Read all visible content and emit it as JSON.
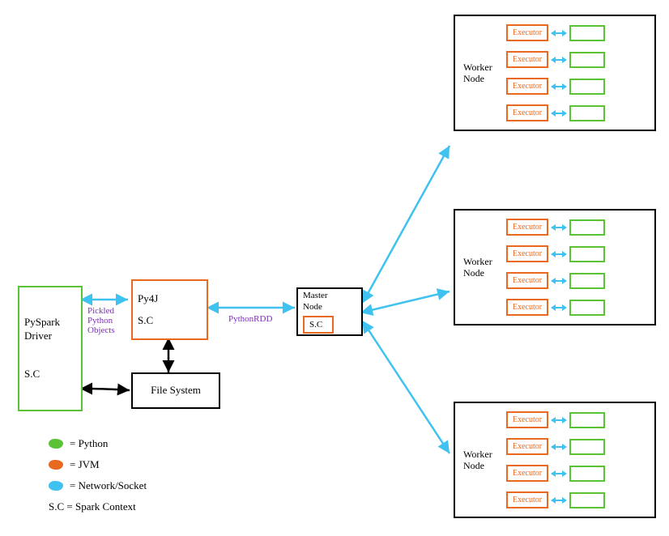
{
  "driver": {
    "title": "PySpark\nDriver",
    "sc": "S.C"
  },
  "py4j": {
    "title": "Py4J",
    "sc": "S.C"
  },
  "filesystem": "File System",
  "master": {
    "title": "Master\nNode",
    "sc": "S.C"
  },
  "labels": {
    "pickled": "Pickled\nPython\nObjects",
    "pythonRDD": "PythonRDD"
  },
  "worker": {
    "label": "Worker\nNode",
    "executor": "Executor"
  },
  "legend": {
    "python": "= Python",
    "jvm": "= JVM",
    "network": "= Network/Socket",
    "sc": "S.C = Spark Context"
  }
}
